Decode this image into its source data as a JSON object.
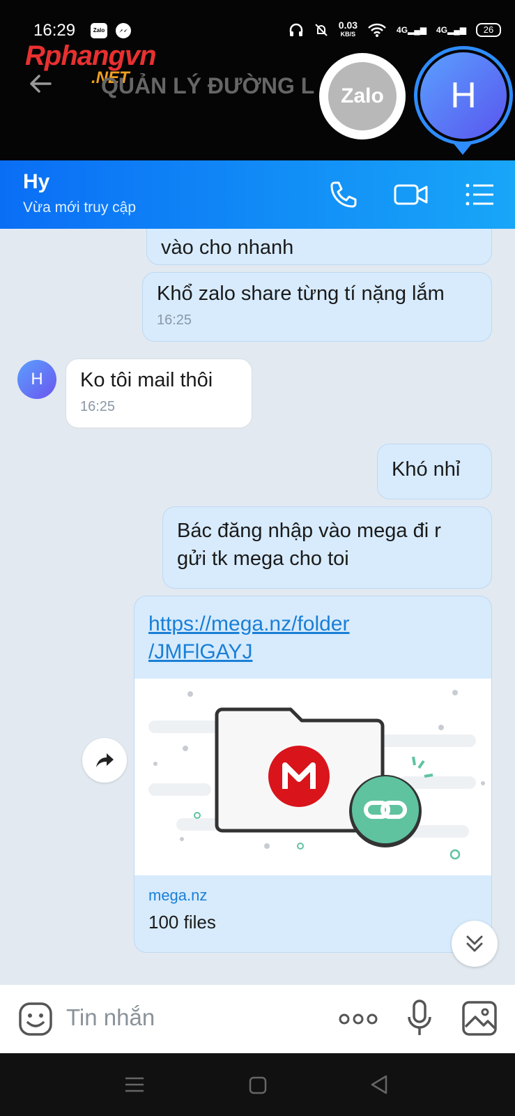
{
  "status_bar": {
    "time": "16:29",
    "zalo_label": "Zalo",
    "net_speed": "0.03",
    "net_unit": "KB/S",
    "signal_1": "4G",
    "signal_2": "4G",
    "battery": "26"
  },
  "watermark": {
    "brand": "Rphangvn",
    "suffix": ".NET"
  },
  "background_header": {
    "title": "QUẢN LÝ ĐƯỜNG L"
  },
  "chat_heads": {
    "zalo_label": "Zalo",
    "contact_initial": "H"
  },
  "chat_header": {
    "name": "Hy",
    "status": "Vừa mới truy cập",
    "icons": [
      "phone-icon",
      "video-icon",
      "menu-icon"
    ]
  },
  "messages": [
    {
      "side": "out",
      "text": "vào cho nhanh",
      "time": ""
    },
    {
      "side": "out",
      "text": "Khổ zalo share từng tí nặng lắm",
      "time": "16:25"
    },
    {
      "side": "in",
      "text": "Ko tôi mail thôi",
      "time": "16:25",
      "avatar": "H"
    },
    {
      "side": "out",
      "text": "Khó nhỉ",
      "time": ""
    },
    {
      "side": "out",
      "text_line1": "Bác đăng nhập vào mega đi r",
      "text_line2": "gửi tk mega cho toi",
      "time": ""
    }
  ],
  "link_preview": {
    "url_line1": "https://mega.nz/folder",
    "url_line2": "/JMFlGAYJ",
    "domain": "mega.nz",
    "description": "100 files",
    "logo_letter": "M"
  },
  "composer": {
    "placeholder": "Tin nhắn",
    "icons": [
      "emoji-icon",
      "more-icon",
      "mic-icon",
      "image-icon"
    ]
  },
  "colors": {
    "header_gradient_start": "#0a6ef5",
    "header_gradient_end": "#18a6f8",
    "bubble_out": "#d7ebfd",
    "bubble_in": "#ffffff",
    "chat_bg": "#e2e9f1",
    "link": "#1a7fd6",
    "mega_red": "#d9141b",
    "link_green": "#5fc3a0"
  }
}
